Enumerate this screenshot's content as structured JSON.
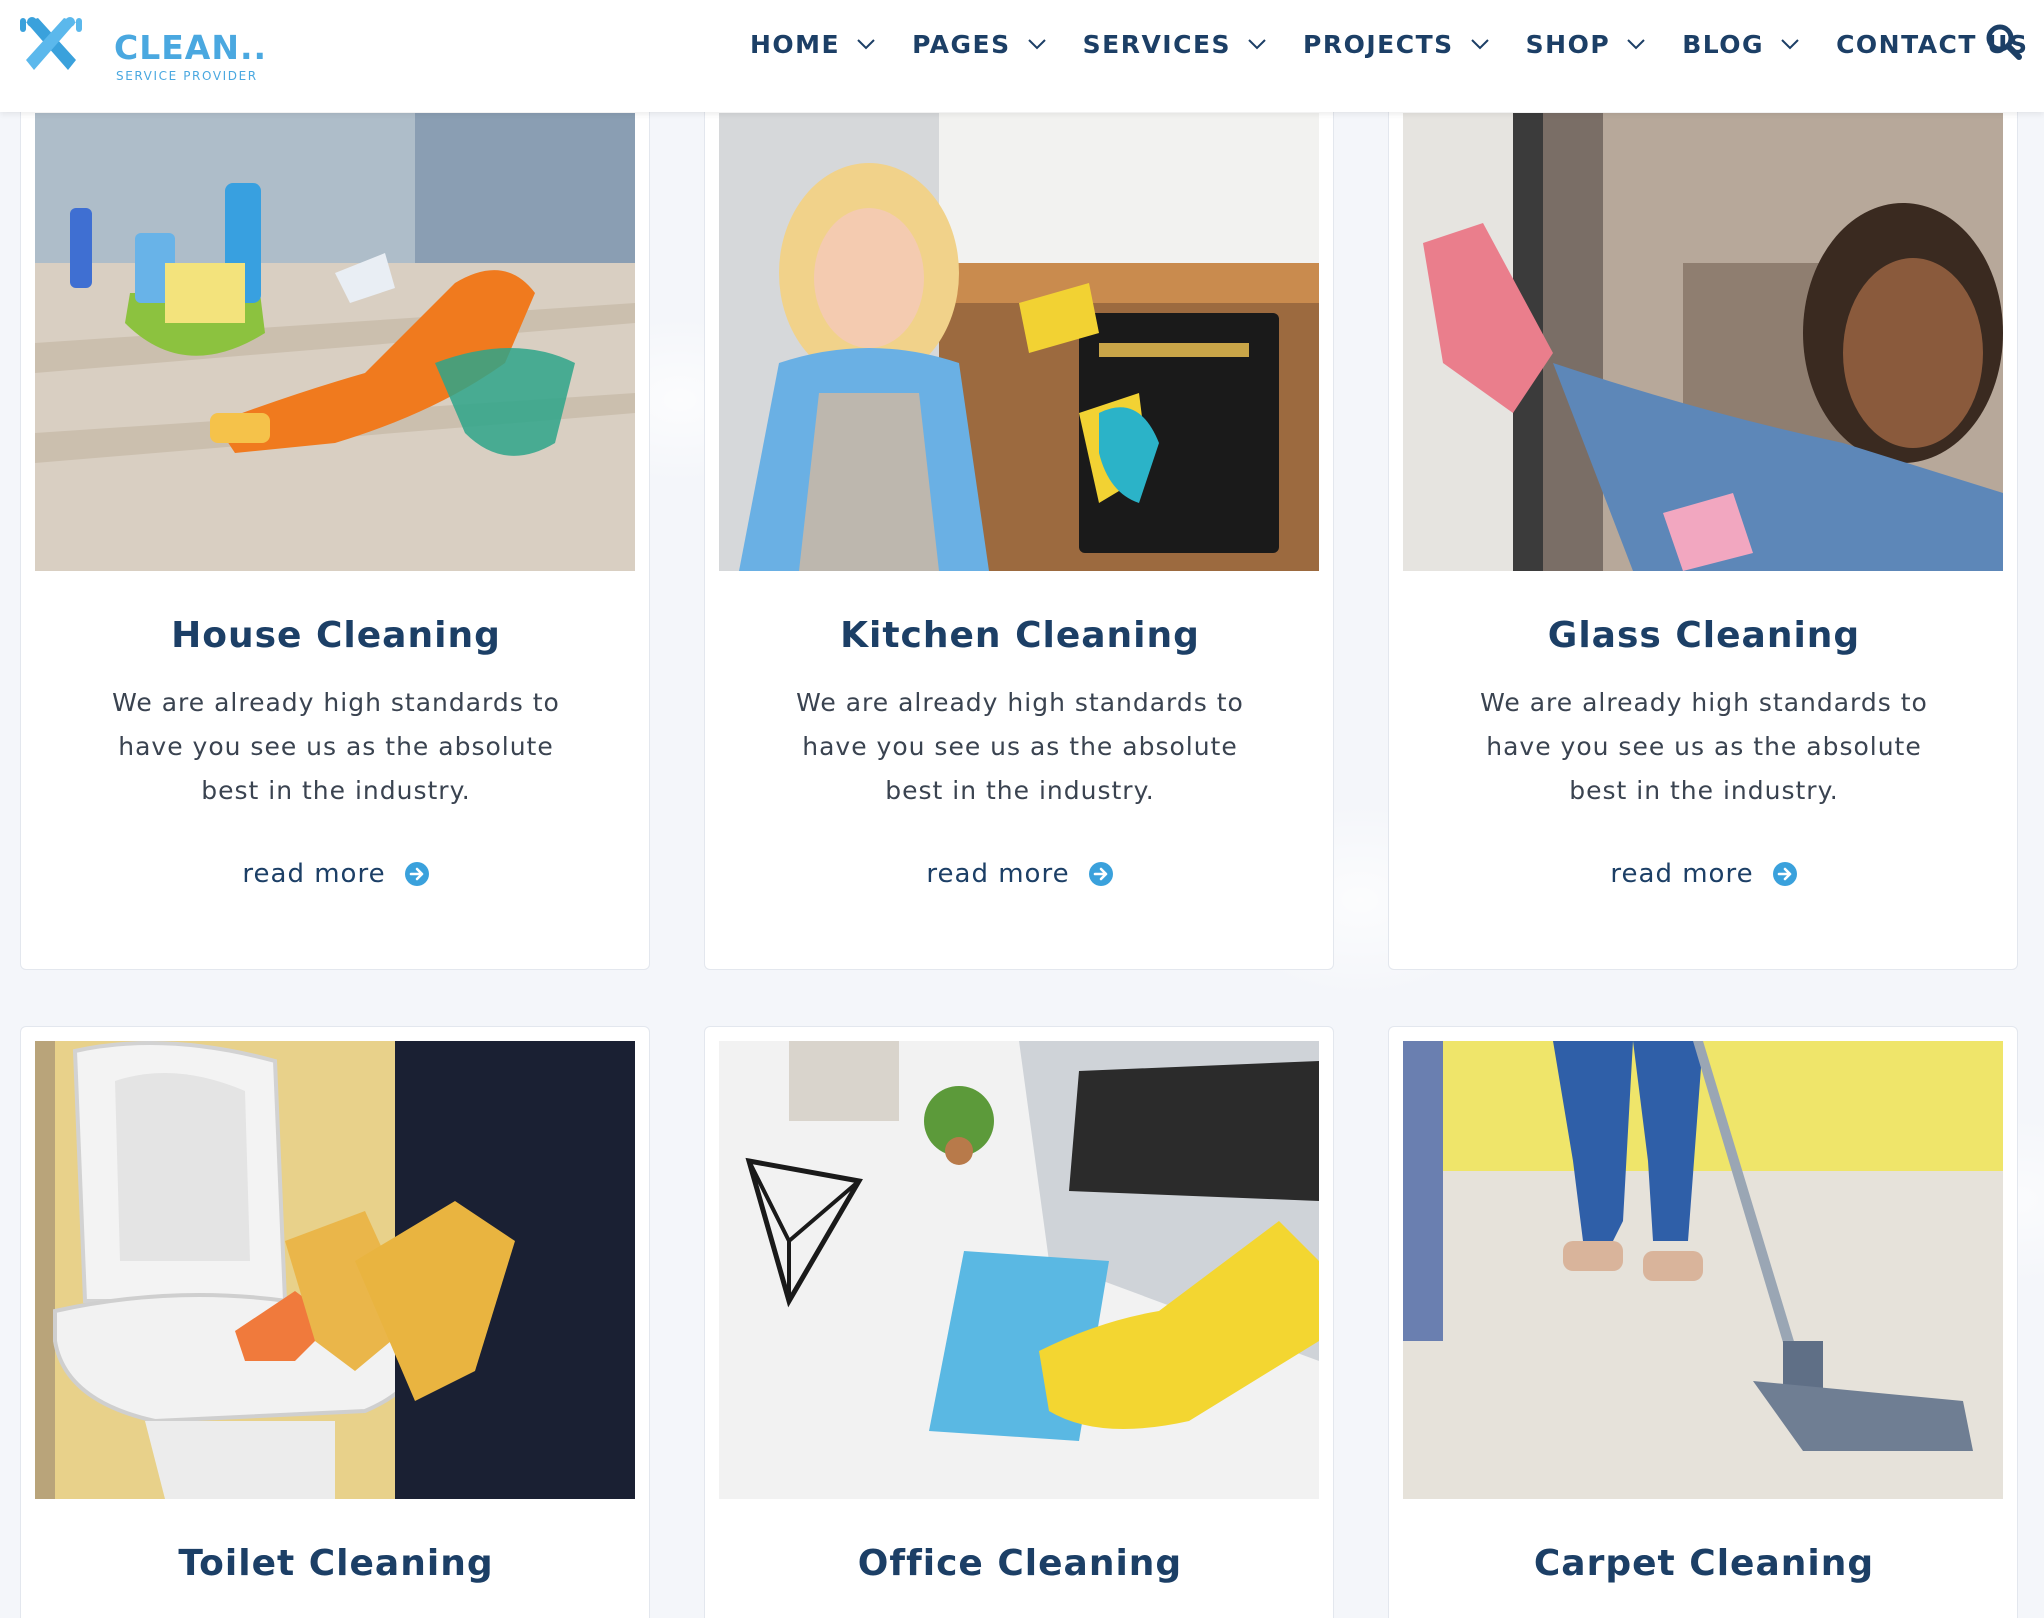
{
  "brand": {
    "title": "CLEAN..",
    "subtitle": "SERVICE PROVIDER",
    "color": "#4aa8e0"
  },
  "nav": {
    "items": [
      {
        "label": "HOME",
        "dropdown": true
      },
      {
        "label": "PAGES",
        "dropdown": true
      },
      {
        "label": "SERVICES",
        "dropdown": true
      },
      {
        "label": "PROJECTS",
        "dropdown": true
      },
      {
        "label": "SHOP",
        "dropdown": true
      },
      {
        "label": "BLOG",
        "dropdown": true
      },
      {
        "label": "CONTACT US",
        "dropdown": false
      }
    ],
    "search_icon": "search-icon"
  },
  "services": [
    {
      "title": "House Cleaning",
      "description": "We are already high standards to have you see us as the absolute best in the industry.",
      "link": "read more",
      "image": "person-with-orange-gloves-cleaning-wooden-floor"
    },
    {
      "title": "Kitchen Cleaning",
      "description": "We are already high standards to have you see us as the absolute best in the industry.",
      "link": "read more",
      "image": "smiling-woman-cleaning-kitchen-oven"
    },
    {
      "title": "Glass Cleaning",
      "description": "We are already high standards to have you see us as the absolute best in the industry.",
      "link": "read more",
      "image": "woman-with-pink-glove-cleaning-window"
    },
    {
      "title": "Toilet Cleaning",
      "description": "",
      "link": "",
      "image": "gloved-hands-cleaning-toilet-bowl"
    },
    {
      "title": "Office Cleaning",
      "description": "",
      "link": "",
      "image": "yellow-glove-wiping-desk-with-laptop"
    },
    {
      "title": "Carpet Cleaning",
      "description": "",
      "link": "",
      "image": "vacuum-cleaner-on-white-carpet"
    }
  ],
  "colors": {
    "heading": "#1c3f66",
    "accent": "#3aa1dc",
    "body_text": "#3a4350",
    "page_bg": "#f4f6fa"
  }
}
